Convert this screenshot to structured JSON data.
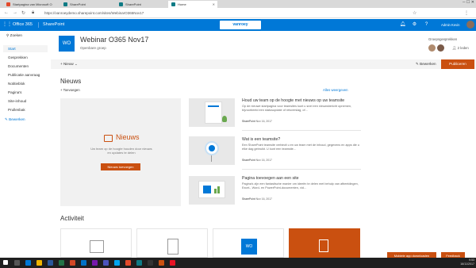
{
  "browser": {
    "tabs": [
      {
        "label": "Startpagina van Microsoft O",
        "color": "#e34a2b"
      },
      {
        "label": "SharePoint",
        "color": "#0f7b85"
      },
      {
        "label": "SharePoint",
        "color": "#0f7b85"
      },
      {
        "label": "Home",
        "color": "#0f7b85"
      }
    ],
    "url": "https://vanroeydemo.sharepoint.com/sites/WebinarO365Nov17"
  },
  "suite": {
    "office": "Office 365",
    "app": "SharePoint",
    "logo": "vanroey",
    "user": "Admin Kevin"
  },
  "nav": {
    "search": "Zoeken",
    "items": [
      "Start",
      "Gesprekken",
      "Documenten",
      "Publicatie aanvraag",
      "Notitieblok",
      "Pagina's",
      "Site-inhoud",
      "Prullenbak"
    ],
    "edit": "Bewerken"
  },
  "site": {
    "initials": "WO",
    "title": "Webinar O365 Nov17",
    "subtitle": "Openbare groep",
    "members_label": "Groepsgesprekken",
    "follow": "2 leden"
  },
  "cmd": {
    "new": "Nieuw",
    "edit": "Bewerken",
    "publish": "Publiceren"
  },
  "news": {
    "title": "Nieuws",
    "add": "Toevoegen",
    "hero_title": "Nieuws",
    "hero_text": "Uw team op de hoogte houden door nieuws en updates te delen",
    "hero_button": "Nieuws toevoegen",
    "items": [
      {
        "title": "Houd uw team op de hoogte met nieuws op uw teamsite",
        "body": "Op de nieuwe startpagina voor teamsites kunt u snel een nieuwsbericht opnemen, bijvoorbeeld een statusupdate of reisverslag, of…",
        "author": "SharePoint",
        "date": "Nov 16, 2017"
      },
      {
        "title": "Wat is een teamsite?",
        "body": "Een SharePoint teamsite verbindt u en uw team met de inhoud, gegevens en apps die u elke dag gebruikt. U kunt een teamsite…",
        "author": "SharePoint",
        "date": "Nov 16, 2017"
      },
      {
        "title": "Pagina toevoegen aan een site",
        "body": "Pagina's zijn een fantastische manier om ideeën te delen met behulp van afbeeldingen, Excel-, Word- en PowerPoint-documenten, vid…",
        "author": "SharePoint",
        "date": "Nov 16, 2017"
      }
    ],
    "see_all": "Alles weergeven"
  },
  "activity": {
    "title": "Activiteit",
    "card3_initials": "WO"
  },
  "feedback": {
    "mobile": "Mobiele app downloaden",
    "feedback": "Feedback"
  },
  "clock": {
    "time": "9:53",
    "date": "16/11/2017"
  },
  "colors": {
    "suite": "#0078d7",
    "accent": "#ca5010"
  }
}
